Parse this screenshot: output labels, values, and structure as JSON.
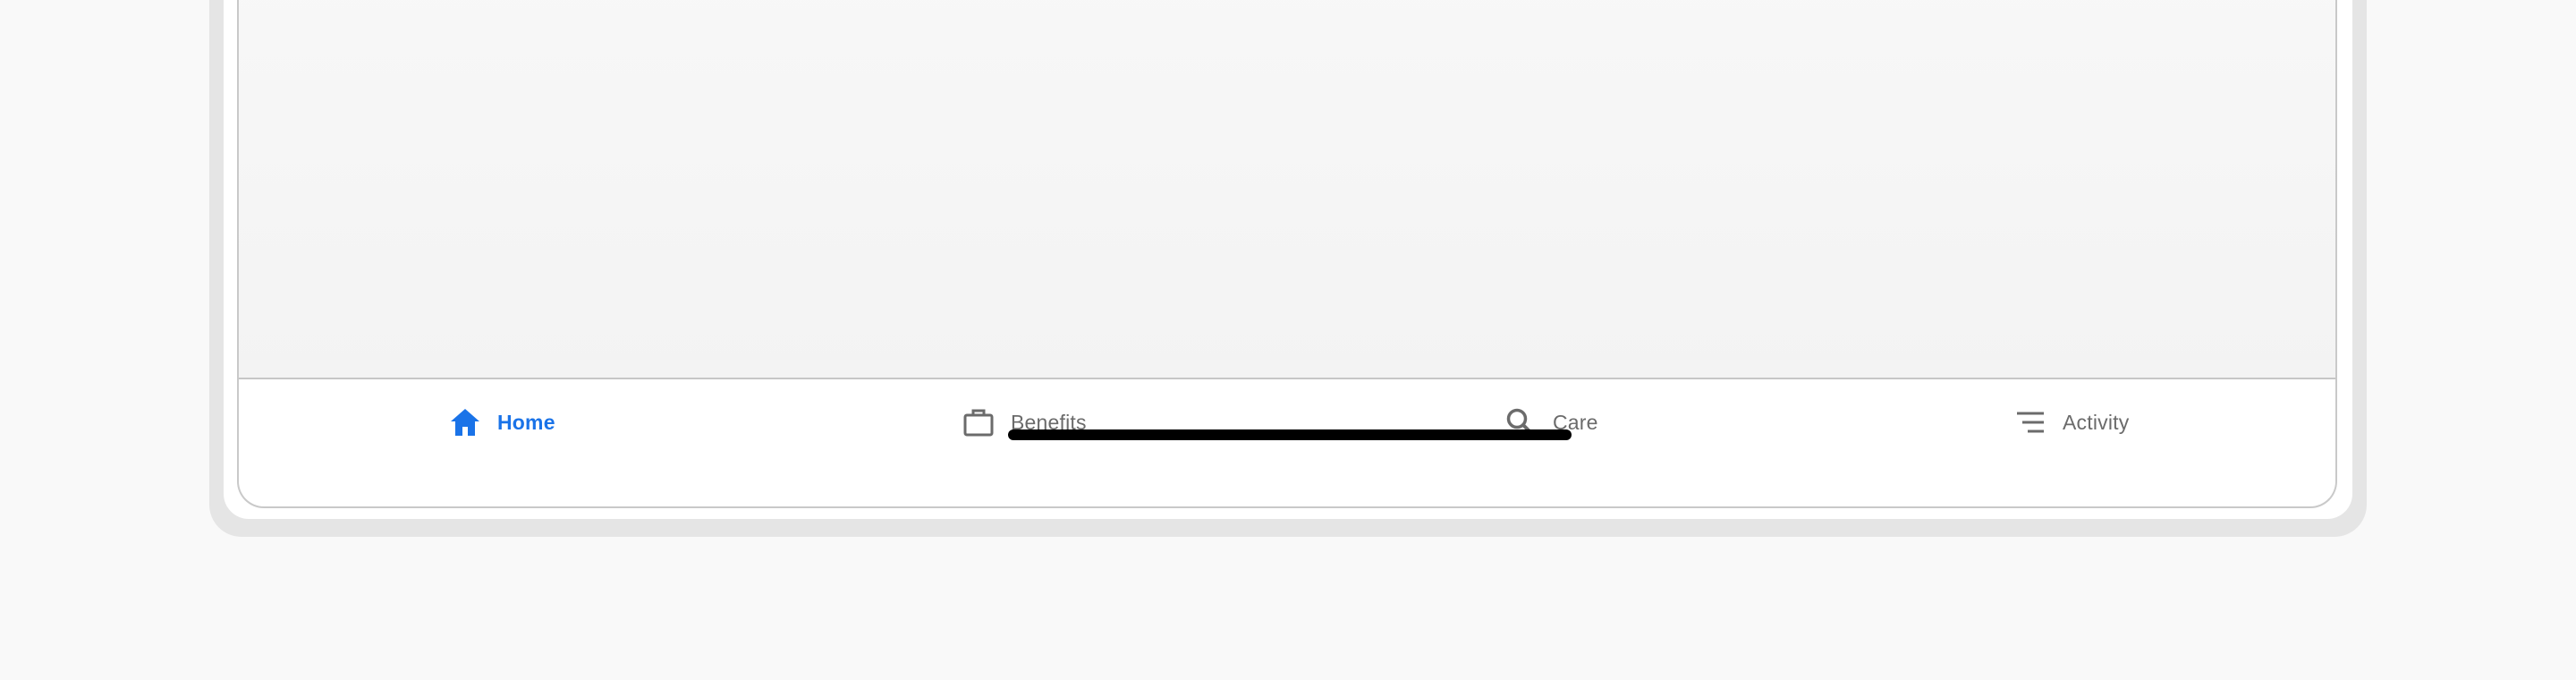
{
  "tabbar": {
    "tabs": [
      {
        "label": "Home",
        "icon": "home-icon",
        "active": true
      },
      {
        "label": "Benefits",
        "icon": "briefcase-icon",
        "active": false
      },
      {
        "label": "Care",
        "icon": "search-icon",
        "active": false
      },
      {
        "label": "Activity",
        "icon": "sort-lines-icon",
        "active": false
      }
    ]
  },
  "colors": {
    "accent": "#1a73e8",
    "inactive": "#6b6b6b",
    "page_background": "#f9f9f9",
    "device_frame": "#e5e5e5"
  }
}
